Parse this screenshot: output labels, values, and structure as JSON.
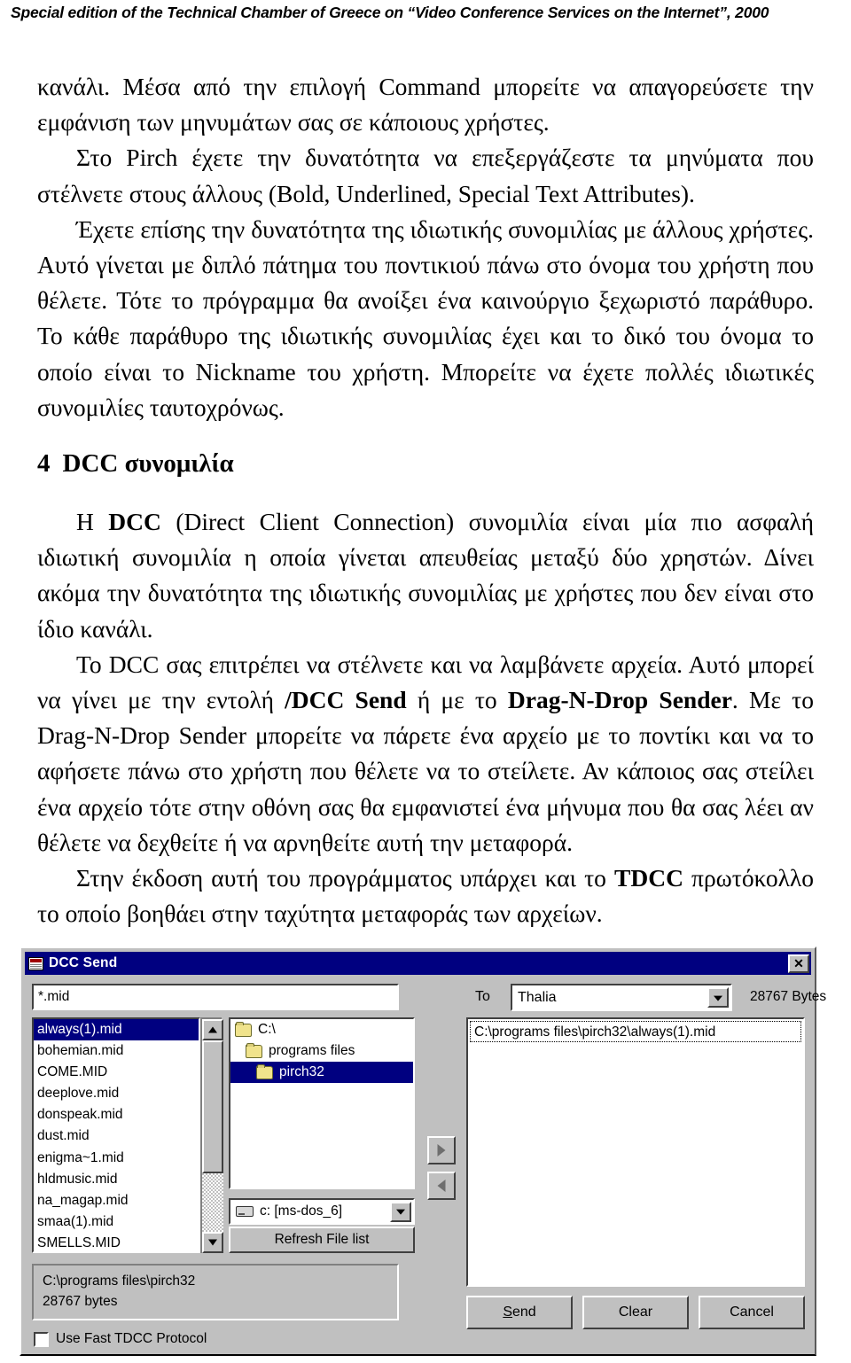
{
  "header": {
    "running_title": "Special edition of the Technical Chamber of Greece on “Video Conference Services on the Internet”, 2000"
  },
  "body": {
    "para1": "κανάλι. Μέσα από την επιλογή Command μπορείτε να απαγορεύσετε την εμφάνιση των μηνυμάτων σας σε κάποιους χρήστες.",
    "para2": "Στο Pirch έχετε την δυνατότητα να επεξεργάζεστε  τα μηνύματα που στέλνετε στους άλλους (Bold, Underlined, Special Text Attributes).",
    "para3": "Έχετε επίσης την δυνατότητα της ιδιωτικής συνομιλίας με άλλους χρήστες. Αυτό γίνεται με διπλό πάτημα του ποντικιού πάνω στο όνομα του χρήστη που θέλετε. Τότε το πρόγραμμα θα ανοίξει ένα καινούργιο ξεχωριστό παράθυρο. Το κάθε παράθυρο της ιδιωτικής συνομιλίας έχει και το δικό του όνομα το οποίο είναι το Nickname του χρήστη. Μπορείτε να έχετε πολλές ιδιωτικές συνομιλίες ταυτοχρόνως.",
    "heading_number": "4",
    "heading_text": "DCC συνομιλία",
    "para4_a": "Η ",
    "para4_b": "DCC",
    "para4_c": " (Direct Client Connection) συνομιλία είναι μία πιο ασφαλή ιδιωτική συνομιλία η οποία γίνεται απευθείας μεταξύ δύο χρηστών. Δίνει ακόμα την δυνατότητα της ιδιωτικής συνομιλίας με χρήστες που δεν είναι στο ίδιο κανάλι.",
    "para5_a": "Το DCC σας επιτρέπει να στέλνετε και να λαμβάνετε αρχεία. Αυτό μπορεί να γίνει με την εντολή ",
    "para5_b": "/DCC Send",
    "para5_c": " ή με το ",
    "para5_d": "Drag-N-Drop Sender",
    "para5_e": ". Με το Drag-N-Drop Sender μπορείτε να πάρετε ένα αρχείο με το ποντίκι και να το αφήσετε πάνω στο χρήστη που θέλετε να το στείλετε. Αν κάποιος σας στείλει ένα αρχείο τότε στην οθόνη σας θα εμφανιστεί ένα μήνυμα που θα σας λέει αν θέλετε να δεχθείτε ή να αρνηθείτε αυτή την μεταφορά.",
    "para6_a": "Στην έκδοση αυτή του προγράμματος υπάρχει και το ",
    "para6_b": "TDCC",
    "para6_c": " πρωτόκολλο το οποίο βοηθάει στην ταχύτητα μεταφοράς των αρχείων."
  },
  "dialog": {
    "title": "DCC Send",
    "close_label": "✕",
    "filter_value": "*.mid",
    "to_label": "To",
    "to_value": "Thalia",
    "bytes_label": "28767 Bytes",
    "file_list": [
      {
        "name": "always(1).mid",
        "selected": true
      },
      {
        "name": "bohemian.mid",
        "selected": false
      },
      {
        "name": "COME.MID",
        "selected": false
      },
      {
        "name": "deeplove.mid",
        "selected": false
      },
      {
        "name": "donspeak.mid",
        "selected": false
      },
      {
        "name": "dust.mid",
        "selected": false
      },
      {
        "name": "enigma~1.mid",
        "selected": false
      },
      {
        "name": "hldmusic.mid",
        "selected": false
      },
      {
        "name": "na_magap.mid",
        "selected": false
      },
      {
        "name": "smaa(1).mid",
        "selected": false
      },
      {
        "name": "SMELLS.MID",
        "selected": false
      }
    ],
    "dir_tree": [
      {
        "name": "C:\\",
        "level": 0,
        "selected": false
      },
      {
        "name": "programs files",
        "level": 1,
        "selected": false
      },
      {
        "name": "pirch32",
        "level": 2,
        "selected": true
      }
    ],
    "drive_value": "c: [ms-dos_6]",
    "refresh_label": "Refresh File list",
    "queue": [
      "C:\\programs files\\pirch32\\always(1).mid"
    ],
    "info_path": "C:\\programs files\\pirch32",
    "info_size": "28767 bytes",
    "checkbox_label": "Use Fast TDCC Protocol",
    "checkbox_checked": false,
    "buttons": {
      "send_prefix": "S",
      "send_rest": "end",
      "clear": "Clear",
      "cancel": "Cancel"
    }
  }
}
